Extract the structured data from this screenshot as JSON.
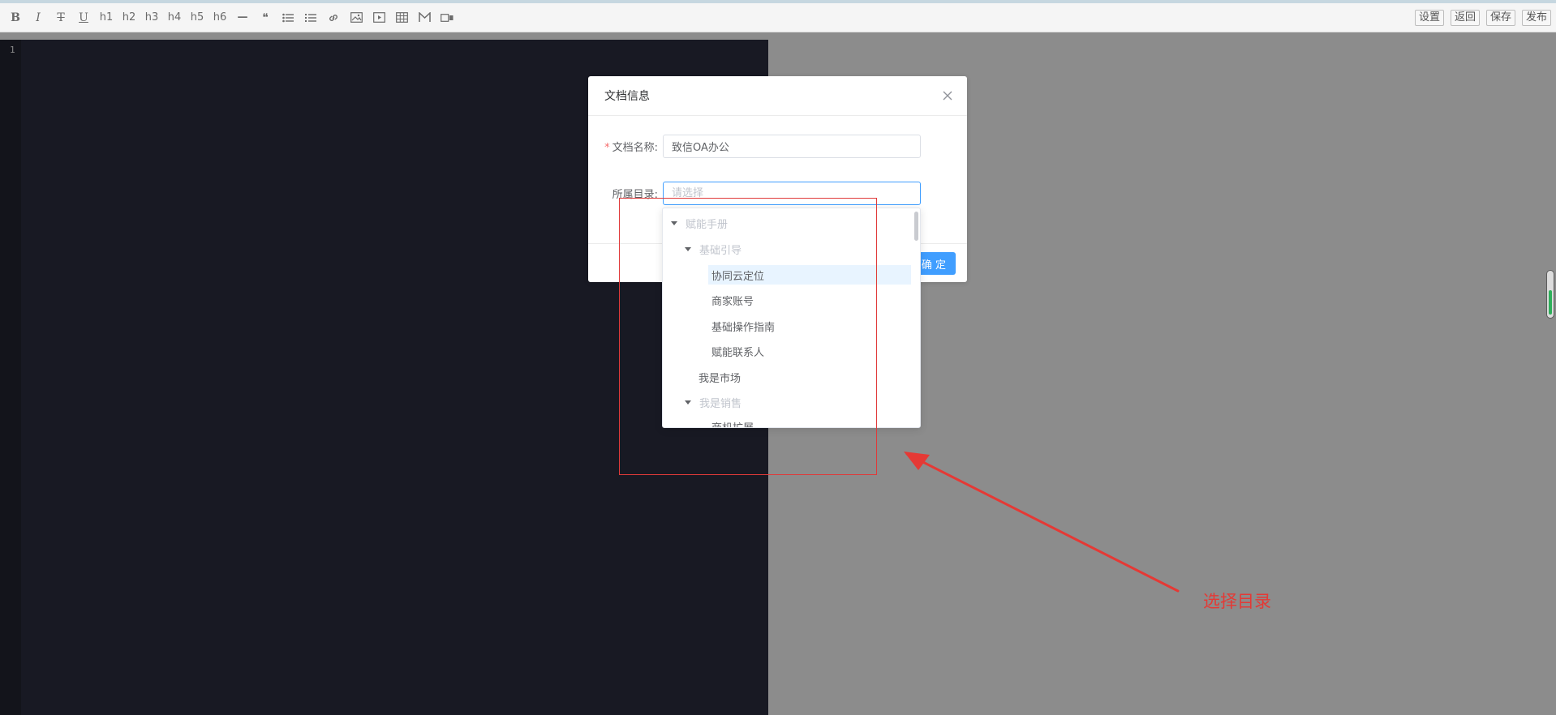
{
  "toolbar": {
    "format_buttons": [
      "B",
      "I",
      "T",
      "U",
      "h1",
      "h2",
      "h3",
      "h4",
      "h5",
      "h6",
      "—",
      "❝"
    ],
    "right_buttons": [
      "设置",
      "返回",
      "保存",
      "发布"
    ]
  },
  "editor": {
    "line_number": "1"
  },
  "dialog": {
    "title": "文档信息",
    "name_label": "文档名称:",
    "name_value": "致信OA办公",
    "dir_label": "所属目录:",
    "dir_placeholder": "请选择",
    "confirm_label": "确 定"
  },
  "tree": {
    "nodes": [
      {
        "label": "赋能手册",
        "state": "disabled"
      },
      {
        "label": "基础引导",
        "state": "disabled"
      },
      {
        "label": "协同云定位",
        "state": "highlight"
      },
      {
        "label": "商家账号",
        "state": "normal"
      },
      {
        "label": "基础操作指南",
        "state": "normal"
      },
      {
        "label": "赋能联系人",
        "state": "normal"
      },
      {
        "label": "我是市场",
        "state": "normal"
      },
      {
        "label": "我是销售",
        "state": "disabled"
      },
      {
        "label": "商机扩展",
        "state": "normal"
      }
    ]
  },
  "annotation": {
    "text": "选择目录",
    "color": "#e53935"
  },
  "colors": {
    "editor_bg": "#181923",
    "overlay": "#8c8c8c",
    "primary": "#409eff",
    "highlight_bg": "#e8f4ff",
    "required": "#f56c6c"
  }
}
